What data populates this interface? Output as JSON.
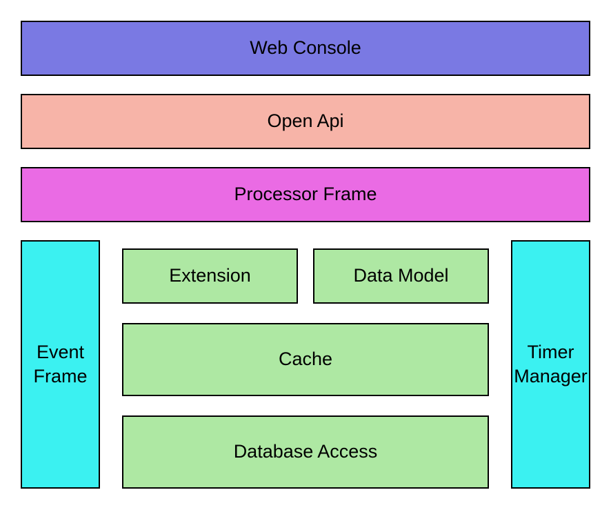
{
  "layers": {
    "top": [
      {
        "id": "web-console",
        "label": "Web Console"
      },
      {
        "id": "open-api",
        "label": "Open Api"
      },
      {
        "id": "processor-frame",
        "label": "Processor Frame"
      }
    ]
  },
  "bottom": {
    "left": {
      "id": "event-frame",
      "label": "Event Frame"
    },
    "right": {
      "id": "timer-manager",
      "label": "Timer Manager"
    },
    "middle": {
      "row1": [
        {
          "id": "extension",
          "label": "Extension"
        },
        {
          "id": "data-model",
          "label": "Data Model"
        }
      ],
      "row2": {
        "id": "cache",
        "label": "Cache"
      },
      "row3": {
        "id": "database-access",
        "label": "Database Access"
      }
    }
  },
  "colors": {
    "web_console": "#7a79e3",
    "open_api": "#f7b4a8",
    "processor_frame": "#ea6be4",
    "side": "#3bf1f1",
    "green": "#aee8a3"
  }
}
